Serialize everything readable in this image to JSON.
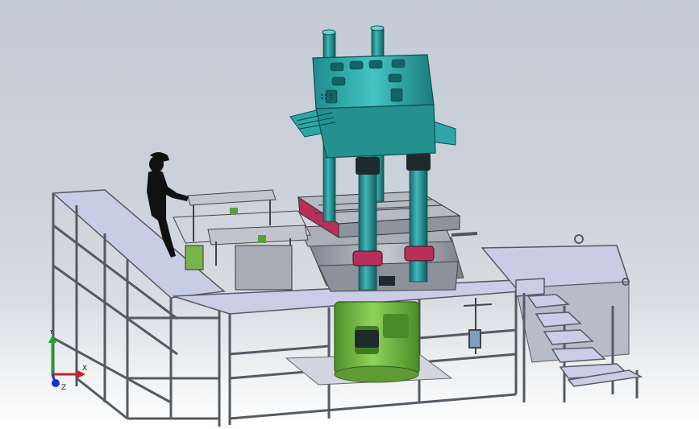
{
  "viewport": {
    "background_top": "#c4cbd6",
    "background_bottom": "#ffffff",
    "accent_teal": "#2fa7a8",
    "accent_green": "#79c04a",
    "accent_magenta": "#b8305a",
    "frame_color": "#6b6f78",
    "panel_color": "#c9cde8"
  },
  "triad": {
    "x_label": "X",
    "y_label": "Y",
    "z_label": "Z",
    "icon": "coordinate-triad-icon"
  },
  "figure": {
    "icon": "operator-silhouette-icon"
  }
}
